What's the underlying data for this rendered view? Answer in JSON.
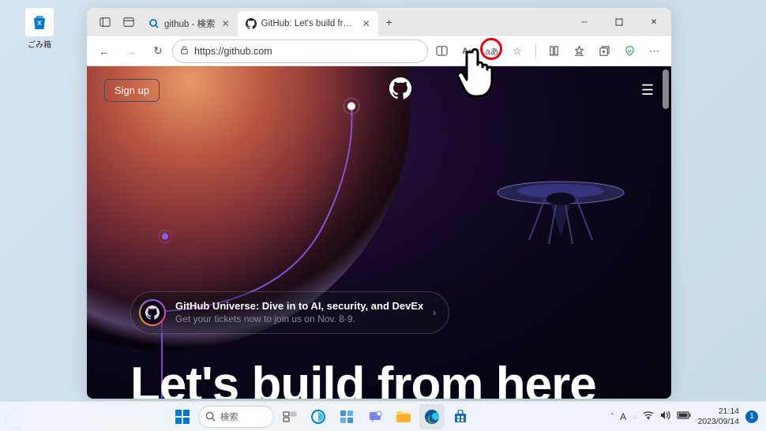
{
  "desktop": {
    "recycle_label": "ごみ箱"
  },
  "browser": {
    "tabs": [
      {
        "title": "github - 検索",
        "active": false
      },
      {
        "title": "GitHub: Let's build from here · Gi",
        "active": true
      }
    ],
    "url": "https://github.com",
    "window_controls": {
      "min": "—",
      "max": "▢",
      "close": "✕"
    }
  },
  "page": {
    "signup": "Sign up",
    "banner_title": "GitHub Universe: Dive in to AI, security, and DevEx",
    "banner_sub": "Get your tickets now to join us on Nov. 8-9.",
    "hero": "Let's build from here"
  },
  "taskbar": {
    "search_placeholder": "検索",
    "ime": "A",
    "time": "21:14",
    "date": "2023/09/14",
    "notif_count": "1"
  }
}
